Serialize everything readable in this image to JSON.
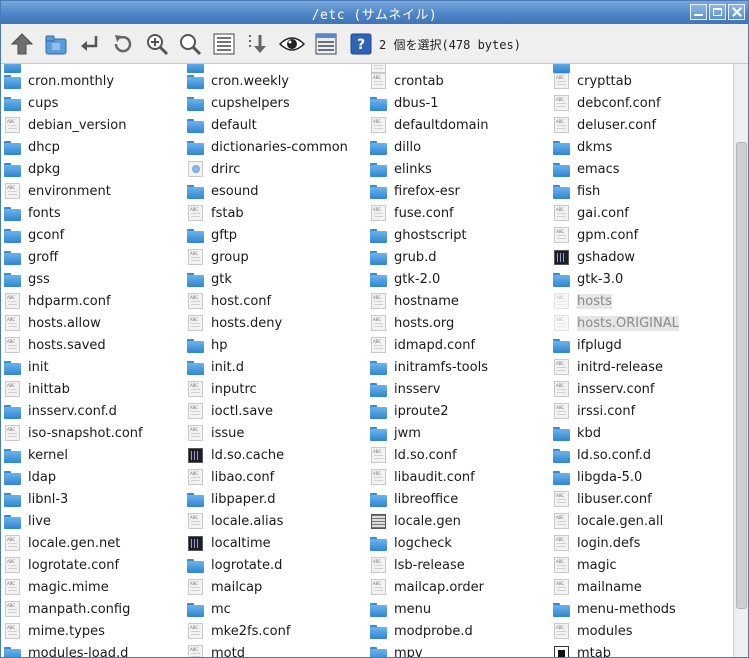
{
  "window": {
    "title": "/etc (サムネイル)"
  },
  "toolbar": {
    "selection_info": "2 個を選択(478 bytes)",
    "buttons": [
      {
        "name": "up-arrow-icon"
      },
      {
        "name": "home-icon"
      },
      {
        "name": "go-arrow-icon"
      },
      {
        "name": "refresh-icon"
      },
      {
        "name": "zoom-in-icon"
      },
      {
        "name": "zoom-out-icon"
      },
      {
        "name": "list-view-icon"
      },
      {
        "name": "sort-icon"
      },
      {
        "name": "eye-icon"
      },
      {
        "name": "details-view-icon"
      },
      {
        "name": "help-icon"
      }
    ]
  },
  "files": {
    "col1": [
      {
        "name": "cron.monthly",
        "type": "folder"
      },
      {
        "name": "cups",
        "type": "folder"
      },
      {
        "name": "debian_version",
        "type": "text"
      },
      {
        "name": "dhcp",
        "type": "folder"
      },
      {
        "name": "dpkg",
        "type": "folder"
      },
      {
        "name": "environment",
        "type": "text"
      },
      {
        "name": "fonts",
        "type": "folder"
      },
      {
        "name": "gconf",
        "type": "folder"
      },
      {
        "name": "groff",
        "type": "folder"
      },
      {
        "name": "gss",
        "type": "folder"
      },
      {
        "name": "hdparm.conf",
        "type": "text"
      },
      {
        "name": "hosts.allow",
        "type": "text"
      },
      {
        "name": "hosts.saved",
        "type": "text"
      },
      {
        "name": "init",
        "type": "folder"
      },
      {
        "name": "inittab",
        "type": "text"
      },
      {
        "name": "insserv.conf.d",
        "type": "folder"
      },
      {
        "name": "iso-snapshot.conf",
        "type": "text"
      },
      {
        "name": "kernel",
        "type": "folder"
      },
      {
        "name": "ldap",
        "type": "folder"
      },
      {
        "name": "libnl-3",
        "type": "folder"
      },
      {
        "name": "live",
        "type": "folder"
      },
      {
        "name": "locale.gen.net",
        "type": "text"
      },
      {
        "name": "logrotate.conf",
        "type": "text"
      },
      {
        "name": "magic.mime",
        "type": "text"
      },
      {
        "name": "manpath.config",
        "type": "text"
      },
      {
        "name": "mime.types",
        "type": "text"
      },
      {
        "name": "modules-load.d",
        "type": "folder"
      }
    ],
    "col2": [
      {
        "name": "cron.weekly",
        "type": "folder"
      },
      {
        "name": "cupshelpers",
        "type": "folder"
      },
      {
        "name": "default",
        "type": "folder"
      },
      {
        "name": "dictionaries-common",
        "type": "folder"
      },
      {
        "name": "drirc",
        "type": "link"
      },
      {
        "name": "esound",
        "type": "folder"
      },
      {
        "name": "fstab",
        "type": "text"
      },
      {
        "name": "gftp",
        "type": "folder"
      },
      {
        "name": "group",
        "type": "text"
      },
      {
        "name": "gtk",
        "type": "folder"
      },
      {
        "name": "host.conf",
        "type": "text"
      },
      {
        "name": "hosts.deny",
        "type": "text"
      },
      {
        "name": "hp",
        "type": "folder"
      },
      {
        "name": "init.d",
        "type": "folder"
      },
      {
        "name": "inputrc",
        "type": "text"
      },
      {
        "name": "ioctl.save",
        "type": "text"
      },
      {
        "name": "issue",
        "type": "text"
      },
      {
        "name": "ld.so.cache",
        "type": "exec"
      },
      {
        "name": "libao.conf",
        "type": "text"
      },
      {
        "name": "libpaper.d",
        "type": "folder"
      },
      {
        "name": "locale.alias",
        "type": "text"
      },
      {
        "name": "localtime",
        "type": "exec"
      },
      {
        "name": "logrotate.d",
        "type": "folder"
      },
      {
        "name": "mailcap",
        "type": "text"
      },
      {
        "name": "mc",
        "type": "folder"
      },
      {
        "name": "mke2fs.conf",
        "type": "text"
      },
      {
        "name": "motd",
        "type": "text"
      }
    ],
    "col3": [
      {
        "name": "crontab",
        "type": "text"
      },
      {
        "name": "dbus-1",
        "type": "folder"
      },
      {
        "name": "defaultdomain",
        "type": "text"
      },
      {
        "name": "dillo",
        "type": "folder"
      },
      {
        "name": "elinks",
        "type": "folder"
      },
      {
        "name": "firefox-esr",
        "type": "folder"
      },
      {
        "name": "fuse.conf",
        "type": "text"
      },
      {
        "name": "ghostscript",
        "type": "folder"
      },
      {
        "name": "grub.d",
        "type": "folder"
      },
      {
        "name": "gtk-2.0",
        "type": "folder"
      },
      {
        "name": "hostname",
        "type": "text"
      },
      {
        "name": "hosts.org",
        "type": "text"
      },
      {
        "name": "idmapd.conf",
        "type": "text"
      },
      {
        "name": "initramfs-tools",
        "type": "folder"
      },
      {
        "name": "insserv",
        "type": "folder"
      },
      {
        "name": "iproute2",
        "type": "folder"
      },
      {
        "name": "jwm",
        "type": "folder"
      },
      {
        "name": "ld.so.conf",
        "type": "text"
      },
      {
        "name": "libaudit.conf",
        "type": "text"
      },
      {
        "name": "libreoffice",
        "type": "folder"
      },
      {
        "name": "locale.gen",
        "type": "grid"
      },
      {
        "name": "logcheck",
        "type": "folder"
      },
      {
        "name": "lsb-release",
        "type": "text"
      },
      {
        "name": "mailcap.order",
        "type": "text"
      },
      {
        "name": "menu",
        "type": "folder"
      },
      {
        "name": "modprobe.d",
        "type": "folder"
      },
      {
        "name": "mpv",
        "type": "folder"
      }
    ],
    "col4": [
      {
        "name": "crypttab",
        "type": "text"
      },
      {
        "name": "debconf.conf",
        "type": "text"
      },
      {
        "name": "deluser.conf",
        "type": "text"
      },
      {
        "name": "dkms",
        "type": "folder"
      },
      {
        "name": "emacs",
        "type": "folder"
      },
      {
        "name": "fish",
        "type": "folder"
      },
      {
        "name": "gai.conf",
        "type": "text"
      },
      {
        "name": "gpm.conf",
        "type": "text"
      },
      {
        "name": "gshadow",
        "type": "exec"
      },
      {
        "name": "gtk-3.0",
        "type": "folder"
      },
      {
        "name": "hosts",
        "type": "text",
        "dim": true
      },
      {
        "name": "hosts.ORIGINAL",
        "type": "text",
        "dim": true
      },
      {
        "name": "ifplugd",
        "type": "folder"
      },
      {
        "name": "initrd-release",
        "type": "text"
      },
      {
        "name": "insserv.conf",
        "type": "text"
      },
      {
        "name": "irssi.conf",
        "type": "text"
      },
      {
        "name": "kbd",
        "type": "folder"
      },
      {
        "name": "ld.so.conf.d",
        "type": "folder"
      },
      {
        "name": "libgda-5.0",
        "type": "folder"
      },
      {
        "name": "libuser.conf",
        "type": "text"
      },
      {
        "name": "locale.gen.all",
        "type": "text"
      },
      {
        "name": "login.defs",
        "type": "text"
      },
      {
        "name": "magic",
        "type": "text"
      },
      {
        "name": "mailname",
        "type": "text"
      },
      {
        "name": "menu-methods",
        "type": "folder"
      },
      {
        "name": "modules",
        "type": "text"
      },
      {
        "name": "mtab",
        "type": "mtab"
      }
    ]
  }
}
